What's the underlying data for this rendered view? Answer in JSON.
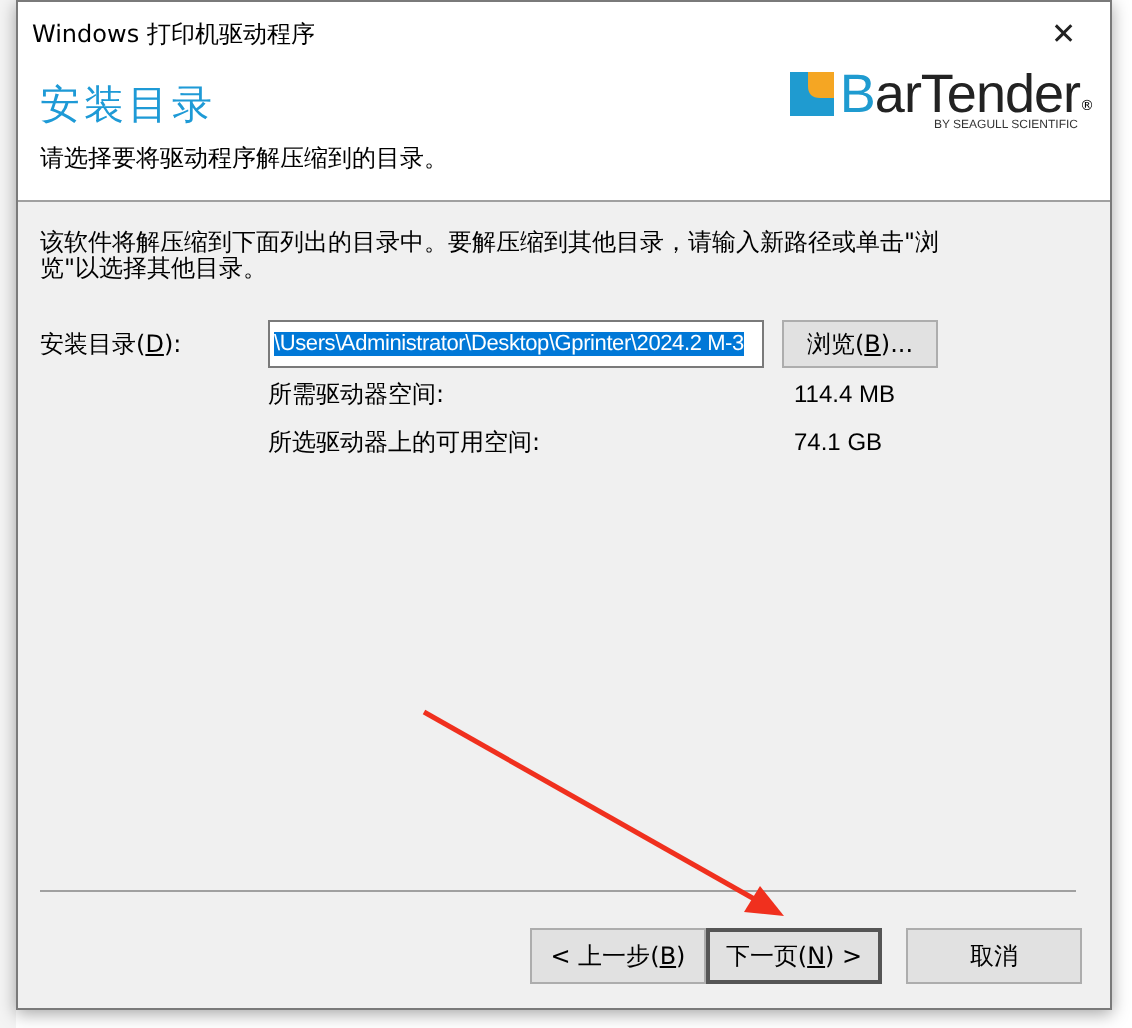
{
  "window": {
    "title": "Windows 打印机驱动程序",
    "close": "✕"
  },
  "header": {
    "title": "安装目录",
    "subtitle": "请选择要将驱动程序解压缩到的目录。",
    "logo": {
      "name": "BarTender",
      "tagline": "BY SEAGULL SCIENTIFIC",
      "mark": "®"
    }
  },
  "description": "该软件将解压缩到下面列出的目录中。要解压缩到其他目录，请输入新路径或单击\"浏览\"以选择其他目录。",
  "directory": {
    "label_before": "安装目录(",
    "mnemonic": "D",
    "label_after": "):",
    "value": "\\Users\\Administrator\\Desktop\\Gprinter\\2024.2 M-3",
    "selected": true,
    "browse": {
      "label_before": "浏览(",
      "mnemonic": "B",
      "label_after": ")..."
    }
  },
  "space": [
    {
      "label": "所需驱动器空间:",
      "value": "114.4 MB"
    },
    {
      "label": "所选驱动器上的可用空间:",
      "value": "74.1 GB"
    }
  ],
  "buttons": [
    {
      "label_before": "< 上一步(",
      "mnemonic": "B",
      "label_after": ")",
      "default": false
    },
    {
      "label_before": "下一页(",
      "mnemonic": "N",
      "label_after": ") >",
      "default": true
    },
    {
      "label_before": "取消",
      "default": false
    }
  ],
  "annotations": [
    {
      "kind": "arrow",
      "color": "#f0301e"
    }
  ]
}
